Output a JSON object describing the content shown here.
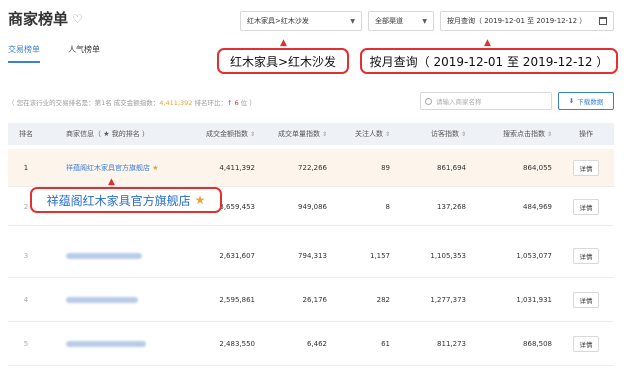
{
  "header": {
    "title": "商家榜单",
    "category_select": "红木家具>红木沙发",
    "channel_select": "全部渠道",
    "date_select": "按月查询（ 2019-12-01 至 2019-12-12 ）"
  },
  "tabs": [
    {
      "label": "交易榜单",
      "active": true
    },
    {
      "label": "人气榜单",
      "active": false
    }
  ],
  "callouts": {
    "category": "红木家具>红木沙发",
    "date": "按月查询（ 2019-12-01 至 2019-12-12 ）",
    "shop": "祥蕴阁红木家具官方旗舰店"
  },
  "info": {
    "prefix": "（ 您在该行业的交易排名是：第1名 成交金额指数：",
    "amount": "4,411,392",
    "mid": " 排名环比：",
    "trend": "↑ 6",
    "suffix": " 位 ）"
  },
  "search": {
    "placeholder": "请输入商家名称"
  },
  "download_label": "下载数据",
  "table": {
    "headers": [
      "排名",
      "商家信息（ ★ 我的排名 ）",
      "成交金额指数",
      "成交单量指数",
      "关注人数",
      "访客指数",
      "搜索点击指数",
      "操作"
    ],
    "detail_label": "详情",
    "rows": [
      {
        "rank": "1",
        "shop": "祥蕴阁红木家具官方旗舰店",
        "amount": "4,411,392",
        "orders": "722,266",
        "followers": "89",
        "visitors": "861,694",
        "search": "864,055"
      },
      {
        "rank": "2",
        "shop": "",
        "amount": "3,659,453",
        "orders": "949,086",
        "followers": "8",
        "visitors": "137,268",
        "search": "484,969"
      },
      {
        "rank": "3",
        "shop": "",
        "amount": "2,631,607",
        "orders": "794,313",
        "followers": "1,157",
        "visitors": "1,105,353",
        "search": "1,053,077"
      },
      {
        "rank": "4",
        "shop": "",
        "amount": "2,595,861",
        "orders": "26,176",
        "followers": "282",
        "visitors": "1,277,373",
        "search": "1,031,931"
      },
      {
        "rank": "5",
        "shop": "",
        "amount": "2,483,550",
        "orders": "6,462",
        "followers": "61",
        "visitors": "811,273",
        "search": "868,508"
      }
    ]
  },
  "colors": {
    "accent": "#3a7fd5",
    "callout_border": "#e23030",
    "star": "#e8a23a"
  }
}
